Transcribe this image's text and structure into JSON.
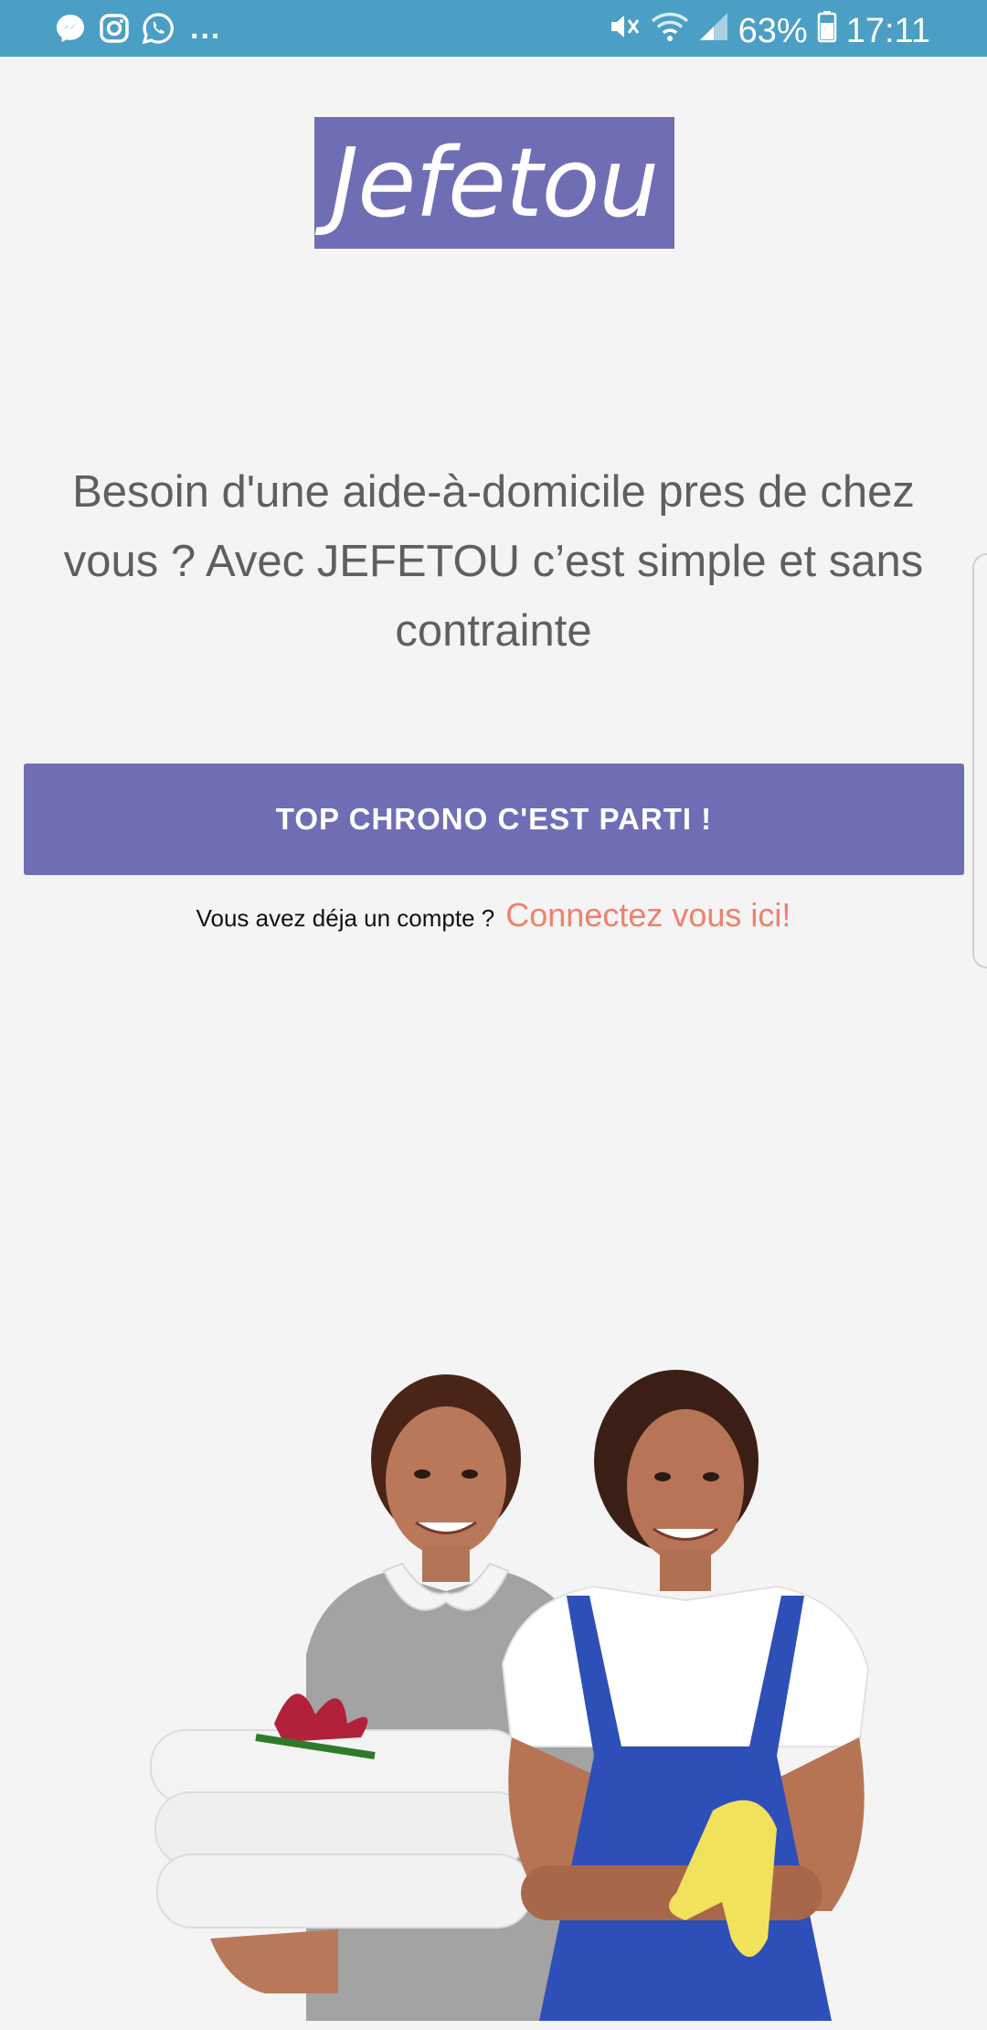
{
  "status_bar": {
    "battery": "63%",
    "time": "17:11",
    "more": "...",
    "left_icons": [
      "messenger-icon",
      "instagram-icon",
      "whatsapp-icon"
    ],
    "right_icons": [
      "mute-icon",
      "wifi-icon",
      "signal-icon",
      "battery-icon"
    ],
    "background": "#4b9fc4"
  },
  "logo": {
    "text": "Jefetou",
    "background": "#6f6eb4"
  },
  "headline": "Besoin d'une aide-à-domicile pres de chez vous ? Avec JEFETOU c’est simple et sans contrainte",
  "cta": {
    "label": "TOP CHRONO C'EST PARTI !",
    "color": "#6f6eb4"
  },
  "login": {
    "question": "Vous avez déja un compte ?",
    "link": "Connectez vous ici!",
    "link_color": "#f0806b"
  },
  "hero": {
    "alt": "two-home-helpers-illustration"
  }
}
